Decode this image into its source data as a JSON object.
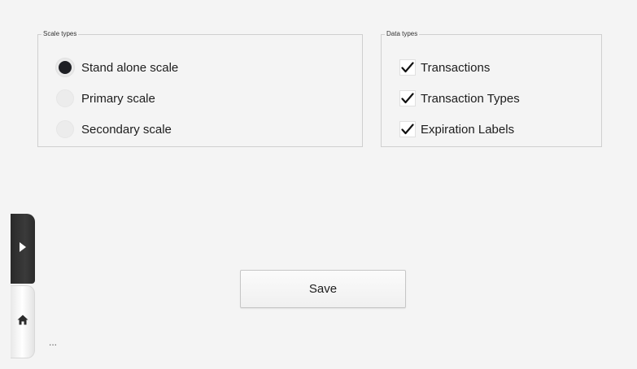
{
  "scale_types": {
    "legend": "Scale types",
    "options": [
      {
        "label": "Stand alone scale",
        "selected": true
      },
      {
        "label": "Primary scale",
        "selected": false
      },
      {
        "label": "Secondary scale",
        "selected": false
      }
    ]
  },
  "data_types": {
    "legend": "Data types",
    "options": [
      {
        "label": "Transactions",
        "checked": true
      },
      {
        "label": "Transaction Types",
        "checked": true
      },
      {
        "label": "Expiration Labels",
        "checked": true
      }
    ]
  },
  "actions": {
    "save_label": "Save"
  },
  "footer": {
    "ellipsis": "..."
  },
  "icons": {
    "expand": "chevron-right-icon",
    "home": "home-icon"
  },
  "colors": {
    "background": "#f4f4f4",
    "radio_selected": "#1e1f24",
    "rail_dark": "#2f2f2f"
  }
}
